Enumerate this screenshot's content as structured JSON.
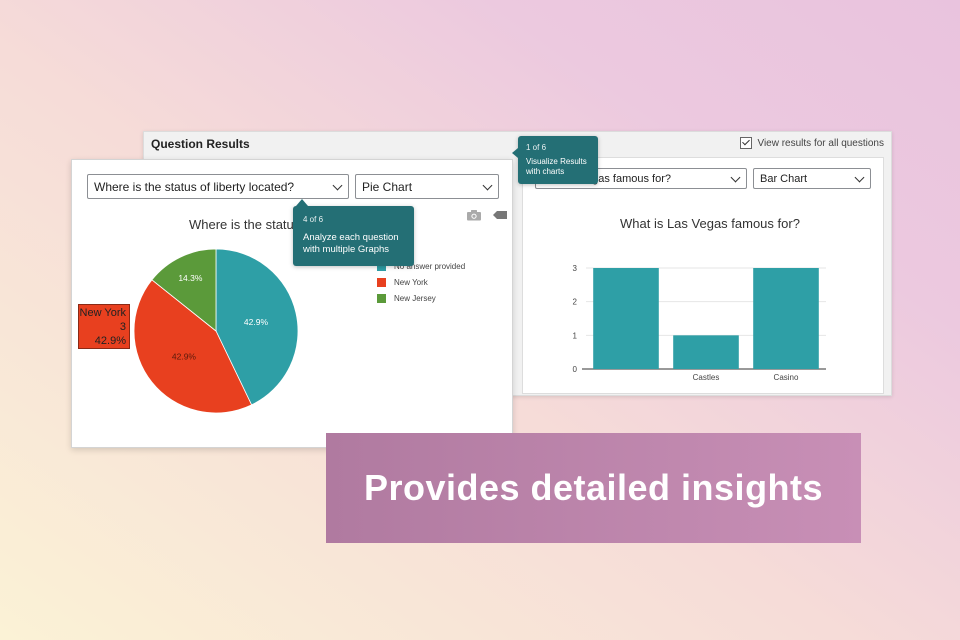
{
  "results_panel": {
    "title": "Question Results",
    "view_all_label": "View results for all questions",
    "view_all_checked": true,
    "question_select": "What is Las Vegas famous for?",
    "question_select_visible": "egas famous for?",
    "chart_type_select": "Bar Chart",
    "chart_title": "What is Las Vegas famous for?"
  },
  "front_panel": {
    "question_select": "Where is the status of liberty located?",
    "chart_type_select": "Pie Chart",
    "chart_title_visible": "Where is the status",
    "legend": [
      {
        "label": "No answer provided",
        "visible_label": "No answer provided",
        "color": "#2e9fa6"
      },
      {
        "label": "New York",
        "visible_label": "New York",
        "color": "#e8401f"
      },
      {
        "label": "New Jersey",
        "visible_label": "New Jersey",
        "color": "#5b9a3a"
      }
    ],
    "hover": {
      "name": "New York",
      "count": "3",
      "pct": "42.9%"
    }
  },
  "tooltips": {
    "pie": {
      "step": "4 of 6",
      "msg": "Analyze each question with multiple Graphs"
    },
    "results": {
      "step": "1 of 6",
      "msg": "Visualize Results with charts"
    }
  },
  "banner": {
    "text": "Provides detailed insights"
  },
  "icons": {
    "camera": "camera-icon",
    "tag": "tag-icon",
    "chevron": "chevron-down-icon",
    "checkbox": "checkbox-icon"
  },
  "colors": {
    "teal": "#2e9fa6",
    "red": "#e8401f",
    "green": "#5b9a3a",
    "tooltip": "#246f75"
  },
  "chart_data": [
    {
      "type": "pie",
      "title": "Where is the status",
      "categories": [
        "No answer provided",
        "New York",
        "New Jersey"
      ],
      "values": [
        42.9,
        42.9,
        14.3
      ],
      "labels": [
        "42.9%",
        "42.9%",
        "14.3%"
      ],
      "colors": [
        "#2e9fa6",
        "#e8401f",
        "#5b9a3a"
      ],
      "legend": "right"
    },
    {
      "type": "bar",
      "title": "What is Las Vegas famous for?",
      "categories": [
        "",
        "Castles",
        "Casino"
      ],
      "values": [
        3,
        1,
        3
      ],
      "yticks": [
        "0",
        "1",
        "2",
        "3"
      ],
      "ylim": [
        0,
        3
      ],
      "color": "#2e9fa6",
      "grid": true
    }
  ]
}
